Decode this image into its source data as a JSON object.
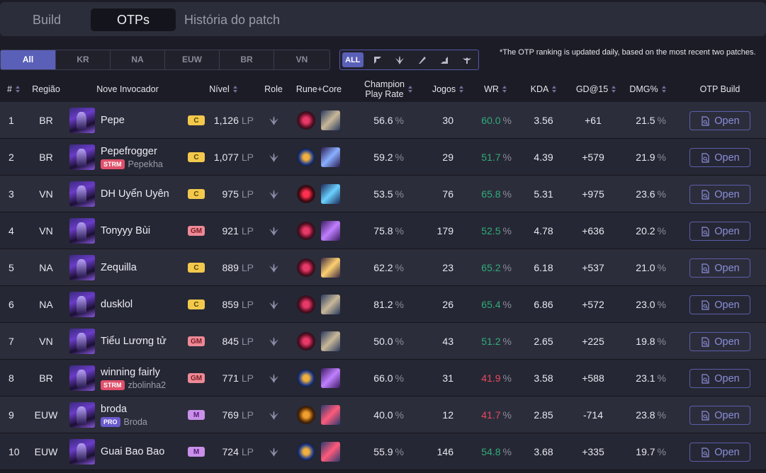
{
  "tabs": {
    "build": "Build",
    "otps": "OTPs",
    "history": "História do patch"
  },
  "regions": [
    "All",
    "KR",
    "NA",
    "EUW",
    "BR",
    "VN"
  ],
  "region_widths_key": "regions",
  "roles": {
    "all_label": "ALL",
    "icons": [
      "top-role-icon",
      "jungle-role-icon",
      "mid-role-icon",
      "bot-role-icon",
      "support-role-icon"
    ]
  },
  "note": "*The OTP ranking is updated daily, based on the most recent two patches.",
  "headers": {
    "rank": "#",
    "region": "Região",
    "summoner": "Nove Invocador",
    "level": "Nível",
    "role": "Role",
    "rune_core": "Rune+Core",
    "play_rate_1": "Champion",
    "play_rate_2": "Play Rate",
    "games": "Jogos",
    "wr": "WR",
    "kda": "KDA",
    "gd": "GD@15",
    "dmg": "DMG%",
    "otp_build": "OTP Build"
  },
  "units": {
    "lp": "LP",
    "pct": "%"
  },
  "open_label": "Open",
  "colors": {
    "accent": "#5a60b8",
    "win": "#2fae7a",
    "loss": "#e84a5f"
  },
  "rows": [
    {
      "rank": "1",
      "region": "BR",
      "name": "Pepe",
      "badge": "",
      "alt": "",
      "tier": "C",
      "lp": "1,126",
      "rune": "electrocute",
      "core": "item-a",
      "play": "56.6",
      "games": "30",
      "wr": "60.0",
      "wr_dir": "up",
      "kda": "3.56",
      "gd": "+61",
      "dmg": "21.5"
    },
    {
      "rank": "2",
      "region": "BR",
      "name": "Pepefrogger",
      "badge": "STRM",
      "alt": "Pepekha",
      "tier": "C",
      "lp": "1,077",
      "rune": "first-strike",
      "core": "item-b",
      "play": "59.2",
      "games": "29",
      "wr": "51.7",
      "wr_dir": "up",
      "kda": "4.39",
      "gd": "+579",
      "dmg": "21.9"
    },
    {
      "rank": "3",
      "region": "VN",
      "name": "DH Uyển Uyên",
      "badge": "",
      "alt": "",
      "tier": "C",
      "lp": "975",
      "rune": "dark-harvest",
      "core": "item-c",
      "play": "53.5",
      "games": "76",
      "wr": "65.8",
      "wr_dir": "up",
      "kda": "5.31",
      "gd": "+975",
      "dmg": "23.6"
    },
    {
      "rank": "4",
      "region": "VN",
      "name": "Tonyyy Bùi",
      "badge": "",
      "alt": "",
      "tier": "GM",
      "lp": "921",
      "rune": "electrocute",
      "core": "item-d",
      "play": "75.8",
      "games": "179",
      "wr": "52.5",
      "wr_dir": "up",
      "kda": "4.78",
      "gd": "+636",
      "dmg": "20.2"
    },
    {
      "rank": "5",
      "region": "NA",
      "name": "Zequilla",
      "badge": "",
      "alt": "",
      "tier": "C",
      "lp": "889",
      "rune": "electrocute",
      "core": "item-e",
      "play": "62.2",
      "games": "23",
      "wr": "65.2",
      "wr_dir": "up",
      "kda": "6.18",
      "gd": "+537",
      "dmg": "21.0"
    },
    {
      "rank": "6",
      "region": "NA",
      "name": "dusklol",
      "badge": "",
      "alt": "",
      "tier": "C",
      "lp": "859",
      "rune": "electrocute",
      "core": "item-a",
      "play": "81.2",
      "games": "26",
      "wr": "65.4",
      "wr_dir": "up",
      "kda": "6.86",
      "gd": "+572",
      "dmg": "23.0"
    },
    {
      "rank": "7",
      "region": "VN",
      "name": "Tiểu Lương tử",
      "badge": "",
      "alt": "",
      "tier": "GM",
      "lp": "845",
      "rune": "electrocute",
      "core": "item-a",
      "play": "50.0",
      "games": "43",
      "wr": "51.2",
      "wr_dir": "up",
      "kda": "2.65",
      "gd": "+225",
      "dmg": "19.8"
    },
    {
      "rank": "8",
      "region": "BR",
      "name": "winning fairly",
      "badge": "STRM",
      "alt": "zbolinha2",
      "tier": "GM",
      "lp": "771",
      "rune": "first-strike",
      "core": "item-d",
      "play": "66.0",
      "games": "31",
      "wr": "41.9",
      "wr_dir": "down",
      "kda": "3.58",
      "gd": "+588",
      "dmg": "23.1"
    },
    {
      "rank": "9",
      "region": "EUW",
      "name": "broda",
      "badge": "PRO",
      "alt": "Broda",
      "tier": "M",
      "lp": "769",
      "rune": "conqueror",
      "core": "item-f",
      "play": "40.0",
      "games": "12",
      "wr": "41.7",
      "wr_dir": "down",
      "kda": "2.85",
      "gd": "-714",
      "dmg": "23.8"
    },
    {
      "rank": "10",
      "region": "EUW",
      "name": "Guai Bao Bao",
      "badge": "",
      "alt": "",
      "tier": "M",
      "lp": "724",
      "rune": "first-strike",
      "core": "item-f",
      "play": "55.9",
      "games": "146",
      "wr": "54.8",
      "wr_dir": "up",
      "kda": "3.68",
      "gd": "+335",
      "dmg": "19.7"
    }
  ]
}
